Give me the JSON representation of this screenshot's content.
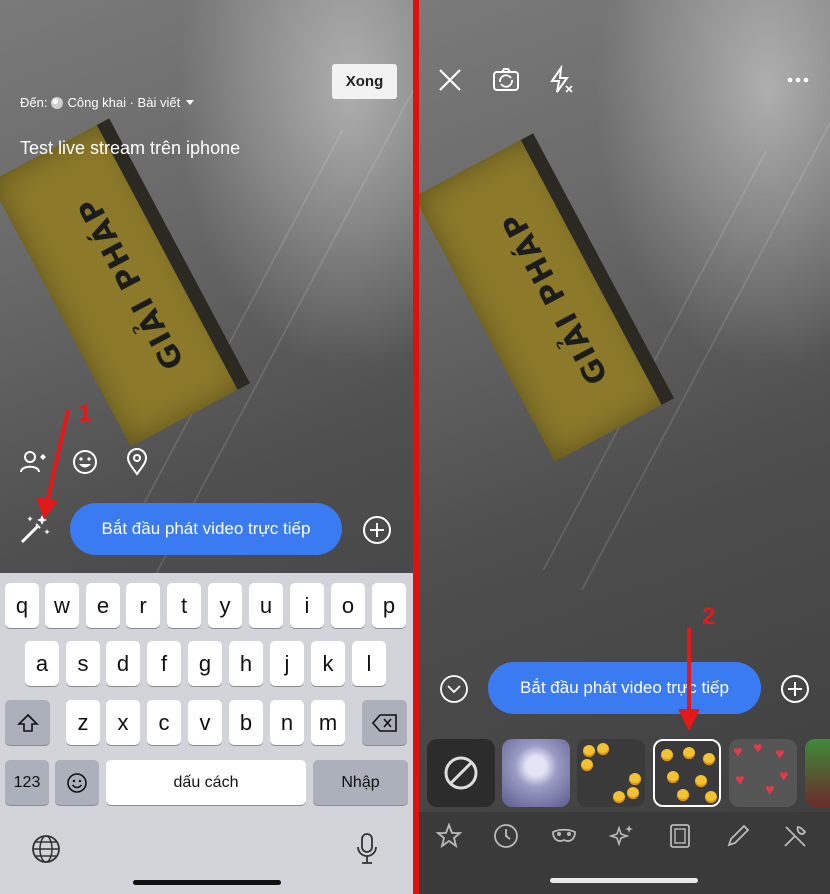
{
  "left": {
    "audience_prefix": "Đến:",
    "audience_value": "Công khai · Bài viết",
    "done_label": "Xong",
    "caption": "Test live stream trên iphone",
    "live_button": "Bắt đầu phát video trực tiếp",
    "annotation": "1",
    "keyboard": {
      "row1": [
        "q",
        "w",
        "e",
        "r",
        "t",
        "y",
        "u",
        "i",
        "o",
        "p"
      ],
      "row2": [
        "a",
        "s",
        "d",
        "f",
        "g",
        "h",
        "j",
        "k",
        "l"
      ],
      "row3": [
        "z",
        "x",
        "c",
        "v",
        "b",
        "n",
        "m"
      ],
      "numbers_key": "123",
      "space_key": "dấu cách",
      "return_key": "Nhập"
    }
  },
  "right": {
    "live_button": "Bắt đầu phát video trực tiếp",
    "annotation": "2"
  },
  "colors": {
    "accent_blue": "#3b7bf2",
    "annotation_red": "#e11010",
    "keyboard_bg": "#d2d4d9"
  },
  "icons": {
    "left": [
      "globe-icon",
      "caret-down-icon",
      "tag-people-icon",
      "emoji-icon",
      "location-pin-icon",
      "magic-wand-icon",
      "add-circle-icon",
      "globe-keyboard-icon",
      "microphone-icon",
      "shift-icon",
      "backspace-icon",
      "emoji-key-icon"
    ],
    "right": [
      "close-icon",
      "flip-camera-icon",
      "flash-off-icon",
      "more-icon",
      "chevron-down-circle-icon",
      "add-circle-icon",
      "no-effect-icon",
      "star-icon",
      "clock-icon",
      "mask-icon",
      "sparkles-icon",
      "frame-icon",
      "pencil-icon",
      "tools-icon"
    ]
  }
}
